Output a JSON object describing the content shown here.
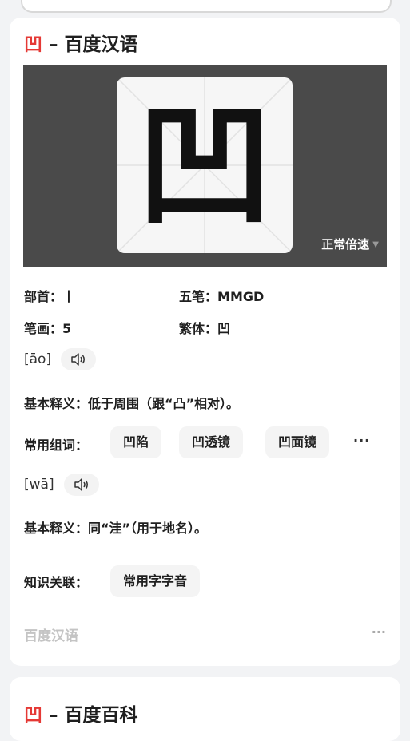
{
  "char": "凹",
  "card1": {
    "title_sep": " – ",
    "title_source": "百度汉语",
    "speed_label": "正常倍速",
    "radical": {
      "label": "部首：",
      "value": "丨"
    },
    "wubi": {
      "label": "五笔：",
      "value": "MMGD"
    },
    "strokes": {
      "label": "笔画：",
      "value": "5"
    },
    "traditional": {
      "label": "繁体：",
      "value": "凹"
    },
    "readings": [
      {
        "pinyin": "[āo]",
        "definition": "基本释义：低于周围（跟“凸”相对）。",
        "words_label": "常用组词：",
        "words": [
          "凹陷",
          "凹透镜",
          "凹面镜"
        ],
        "more": "···"
      },
      {
        "pinyin": "[wā]",
        "definition": "基本释义：同“洼”（用于地名）。"
      }
    ],
    "knowledge_label": "知识关联：",
    "knowledge_chip": "常用字字音",
    "footer_source": "百度汉语",
    "footer_more": "···"
  },
  "card2": {
    "title_sep": " – ",
    "title_source": "百度百科"
  },
  "icons": {
    "sound": "speaker-icon",
    "speed_caret": "caret-down-icon"
  },
  "colors": {
    "accent": "#e53935",
    "stage_bg": "#4a4a4a",
    "chip_bg": "#f4f4f4",
    "muted": "#c4c4c4"
  }
}
